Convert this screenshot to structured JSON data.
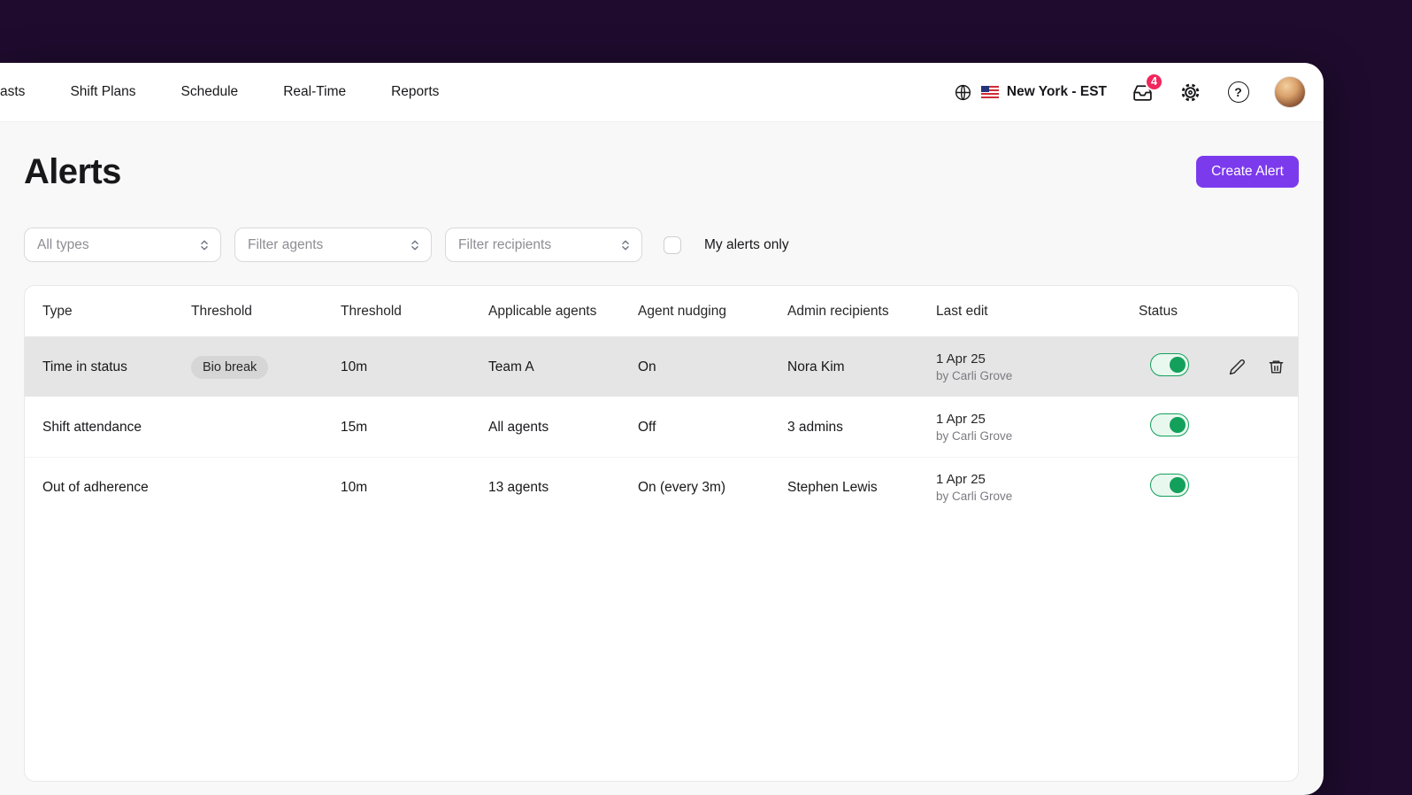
{
  "nav": {
    "items": [
      "asts",
      "Shift Plans",
      "Schedule",
      "Real-Time",
      "Reports"
    ],
    "timezone": "New York - EST",
    "notification_count": "4"
  },
  "page": {
    "title": "Alerts",
    "create_button": "Create Alert"
  },
  "filters": {
    "type_placeholder": "All types",
    "agents_placeholder": "Filter agents",
    "recipients_placeholder": "Filter recipients",
    "my_alerts_label": "My alerts only",
    "my_alerts_checked": false
  },
  "table": {
    "columns": [
      "Type",
      "Threshold",
      "Threshold",
      "Applicable agents",
      "Agent nudging",
      "Admin recipients",
      "Last edit",
      "Status"
    ],
    "rows": [
      {
        "type": "Time in status",
        "badge": "Bio break",
        "threshold": "10m",
        "agents": "Team A",
        "nudging": "On",
        "recipients": "Nora Kim",
        "last_edit_date": "1 Apr 25",
        "last_edit_by": "by Carli Grove",
        "status_on": true,
        "highlighted": true
      },
      {
        "type": "Shift attendance",
        "badge": "",
        "threshold": "15m",
        "agents": "All agents",
        "nudging": "Off",
        "recipients": "3 admins",
        "last_edit_date": "1 Apr 25",
        "last_edit_by": "by Carli Grove",
        "status_on": true,
        "highlighted": false
      },
      {
        "type": "Out of adherence",
        "badge": "",
        "threshold": "10m",
        "agents": "13 agents",
        "nudging": "On (every 3m)",
        "recipients": "Stephen Lewis",
        "last_edit_date": "1 Apr 25",
        "last_edit_by": "by Carli Grove",
        "status_on": true,
        "highlighted": false
      }
    ]
  },
  "colors": {
    "accent": "#7c3aed",
    "toggle_green": "#13a05b",
    "notification_badge": "#f2265c",
    "row_highlight": "#e5e5e5",
    "desktop_background": "#1f0b2e"
  },
  "icons": {
    "globe": "globe-icon",
    "us_flag": "us-flag-icon",
    "inbox": "inbox-icon",
    "settings": "gear-icon",
    "help": "help-icon",
    "edit": "pencil-icon",
    "delete": "trash-icon",
    "select_chevrons": "chevron-updown-icon"
  }
}
